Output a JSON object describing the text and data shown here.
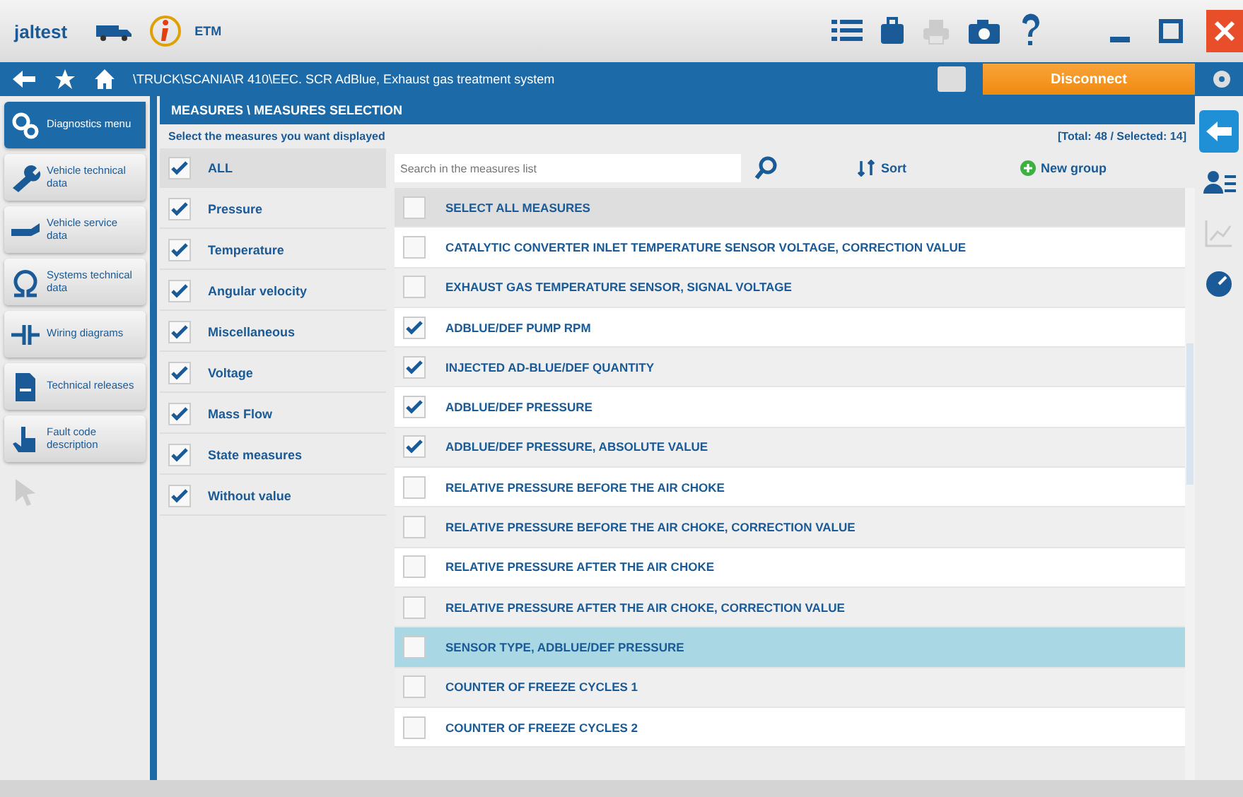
{
  "app": {
    "logo": "jaltest",
    "toolbar_labels": [
      "ETM"
    ]
  },
  "breadcrumb": "\\TRUCK\\SCANIA\\R 410\\EEC. SCR AdBlue, Exhaust gas treatment system",
  "disconnect_button": "Disconnect",
  "sidebar": {
    "items": [
      {
        "label": "Diagnostics menu",
        "kind": "diagnostics",
        "selected": true,
        "disabled": false
      },
      {
        "label": "Vehicle technical data",
        "kind": "wrench",
        "selected": false,
        "disabled": false
      },
      {
        "label": "Vehicle service data",
        "kind": "service",
        "selected": false,
        "disabled": false
      },
      {
        "label": "Systems technical data",
        "kind": "omega",
        "selected": false,
        "disabled": false
      },
      {
        "label": "Wiring diagrams",
        "kind": "wiring",
        "selected": false,
        "disabled": false
      },
      {
        "label": "Technical releases",
        "kind": "document",
        "selected": false,
        "disabled": false
      },
      {
        "label": "Fault code description",
        "kind": "hand",
        "selected": false,
        "disabled": false
      },
      {
        "kind": "cursor",
        "selected": false,
        "disabled": true
      }
    ]
  },
  "panel": {
    "title": "MEASURES \\ MEASURES SELECTION",
    "instruction": "Select the measures you want displayed",
    "totals": "[Total: 48 / Selected: 14]"
  },
  "categories": [
    {
      "label": "ALL",
      "checked": true
    },
    {
      "label": "Pressure",
      "checked": true
    },
    {
      "label": "Temperature",
      "checked": true
    },
    {
      "label": "Angular velocity",
      "checked": true
    },
    {
      "label": "Miscellaneous",
      "checked": true
    },
    {
      "label": "Voltage",
      "checked": true
    },
    {
      "label": "Mass Flow",
      "checked": true
    },
    {
      "label": "State measures",
      "checked": true
    },
    {
      "label": "Without value",
      "checked": true
    }
  ],
  "search": {
    "placeholder": "Search in the measures list"
  },
  "sort_button": "Sort",
  "new_group_button": "New group",
  "select_all": {
    "label": "SELECT ALL MEASURES",
    "checked": false
  },
  "measures": [
    {
      "label": "CATALYTIC CONVERTER INLET TEMPERATURE SENSOR VOLTAGE, CORRECTION VALUE",
      "checked": false,
      "selected": false
    },
    {
      "label": "EXHAUST GAS TEMPERATURE SENSOR, SIGNAL VOLTAGE",
      "checked": false,
      "selected": false
    },
    {
      "label": "ADBLUE/DEF PUMP RPM",
      "checked": true,
      "selected": false
    },
    {
      "label": "INJECTED AD-BLUE/DEF QUANTITY",
      "checked": true,
      "selected": false
    },
    {
      "label": "ADBLUE/DEF PRESSURE",
      "checked": true,
      "selected": false
    },
    {
      "label": "ADBLUE/DEF PRESSURE, ABSOLUTE VALUE",
      "checked": true,
      "selected": false
    },
    {
      "label": "RELATIVE PRESSURE BEFORE THE AIR CHOKE",
      "checked": false,
      "selected": false
    },
    {
      "label": "RELATIVE PRESSURE BEFORE THE AIR CHOKE, CORRECTION VALUE",
      "checked": false,
      "selected": false
    },
    {
      "label": "RELATIVE PRESSURE AFTER THE AIR CHOKE",
      "checked": false,
      "selected": false
    },
    {
      "label": "RELATIVE PRESSURE AFTER THE AIR CHOKE, CORRECTION VALUE",
      "checked": false,
      "selected": false
    },
    {
      "label": "SENSOR TYPE, ADBLUE/DEF PRESSURE",
      "checked": false,
      "selected": true
    },
    {
      "label": "COUNTER OF FREEZE CYCLES 1",
      "checked": false,
      "selected": false
    },
    {
      "label": "COUNTER OF FREEZE CYCLES 2",
      "checked": false,
      "selected": false
    }
  ]
}
